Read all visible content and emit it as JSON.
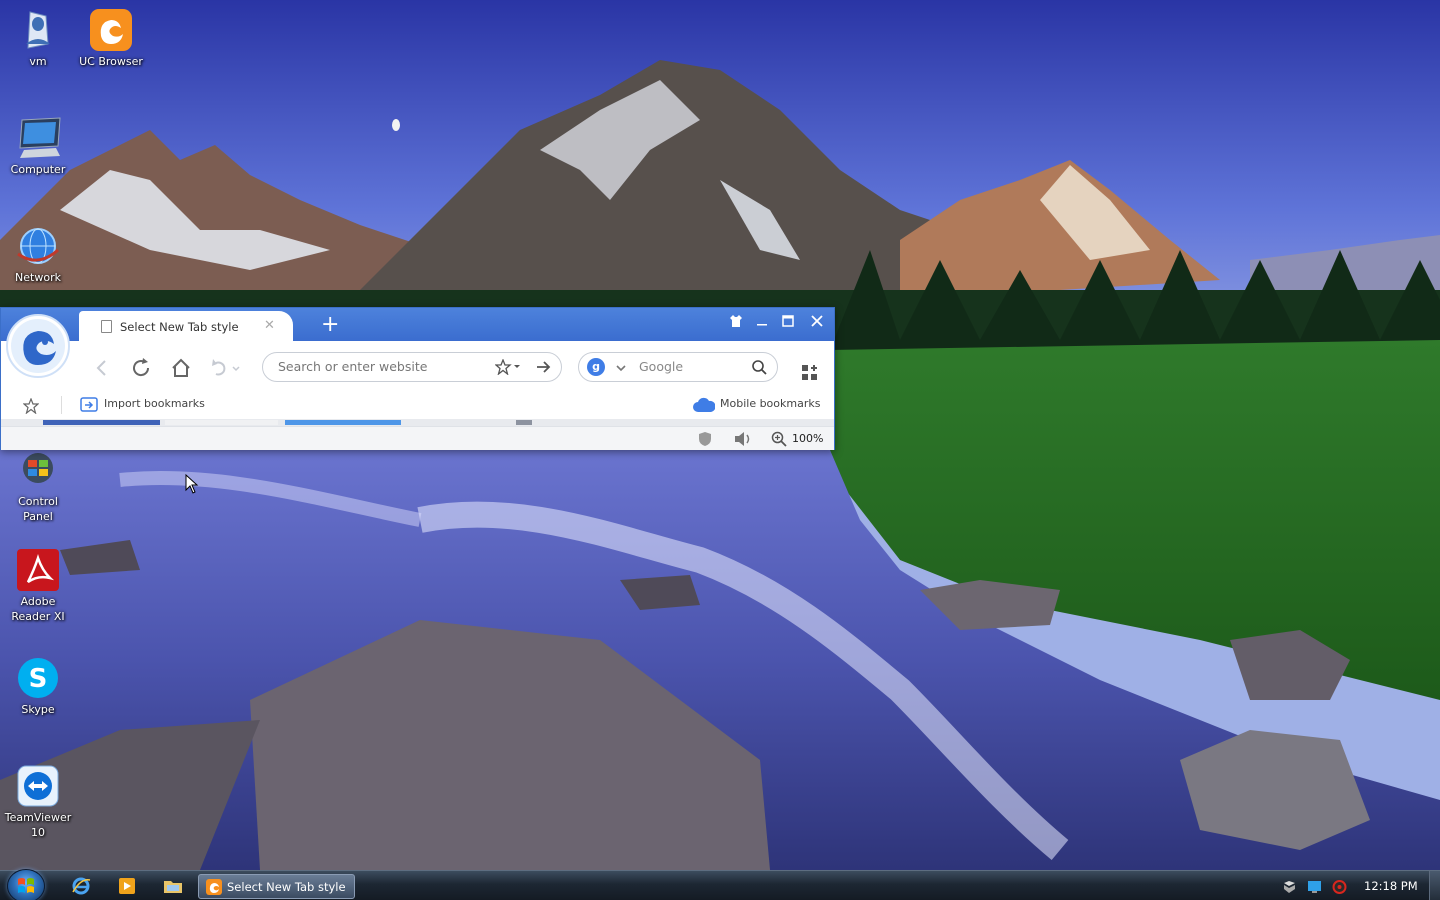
{
  "desktop": {
    "icons": [
      {
        "id": "vm",
        "label": "vm"
      },
      {
        "id": "uc",
        "label": "UC Browser"
      },
      {
        "id": "computer",
        "label": "Computer"
      },
      {
        "id": "network",
        "label": "Network"
      },
      {
        "id": "control-panel",
        "label": "Control\nPanel"
      },
      {
        "id": "adobe",
        "label": "Adobe\nReader XI"
      },
      {
        "id": "skype",
        "label": "Skype"
      },
      {
        "id": "teamviewer",
        "label": "TeamViewer\n10"
      }
    ]
  },
  "browser": {
    "tab_title": "Select New Tab style",
    "new_tab_symbol": "+",
    "address_placeholder": "Search or enter website",
    "search_engine_letter": "g",
    "search_placeholder": "Google",
    "bookmarks": {
      "import_label": "Import bookmarks",
      "mobile_label": "Mobile bookmarks"
    },
    "zoom": "100%"
  },
  "taskbar": {
    "task_label": "Select New Tab style ...",
    "clock": "12:18 PM"
  },
  "colors": {
    "titlebar": "#3b6dcf",
    "accent": "#3f7de6",
    "taskbar": "#1d2733"
  }
}
